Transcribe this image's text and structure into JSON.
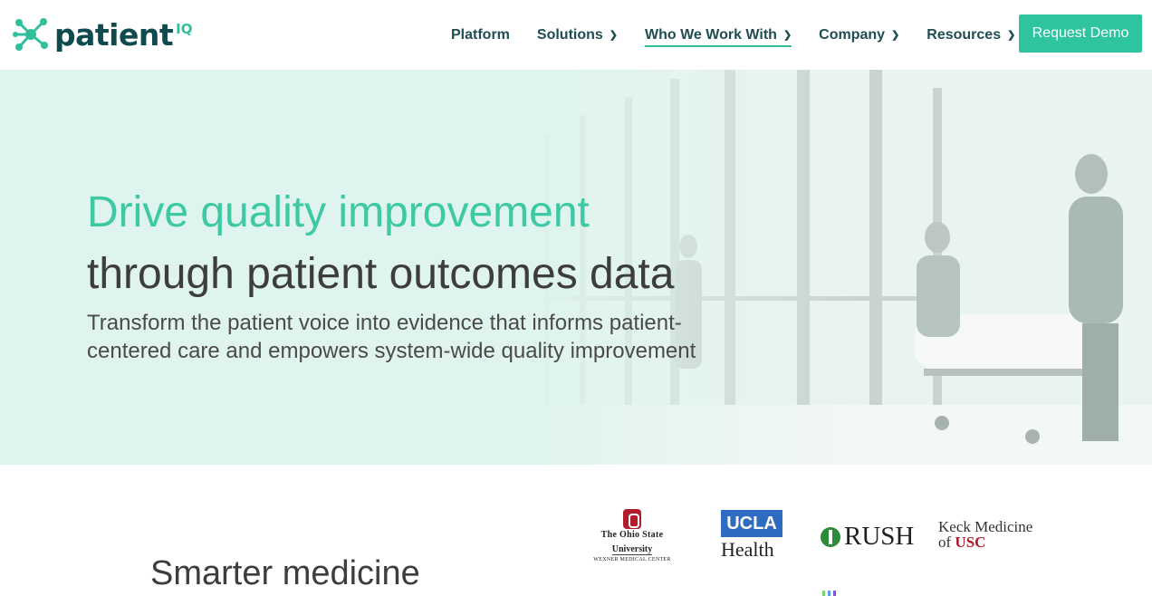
{
  "header": {
    "logo": {
      "brand": "patient",
      "suffix": "IQ",
      "icon": "network-nodes-icon"
    },
    "nav": [
      {
        "label": "Platform",
        "has_dropdown": false,
        "active": false
      },
      {
        "label": "Solutions",
        "has_dropdown": true,
        "active": false
      },
      {
        "label": "Who We Work With",
        "has_dropdown": true,
        "active": true
      },
      {
        "label": "Company",
        "has_dropdown": true,
        "active": false
      },
      {
        "label": "Resources",
        "has_dropdown": true,
        "active": false
      }
    ],
    "cta_label": "Request Demo"
  },
  "hero": {
    "title_line1": "Drive quality improvement",
    "title_line2": "through patient outcomes data",
    "subtitle": "Transform the patient voice into evidence that informs patient-centered care and empowers system-wide quality improvement"
  },
  "section": {
    "heading": "Smarter medicine"
  },
  "partner_logos": {
    "osu": {
      "line1": "The Ohio State",
      "line2": "University",
      "line3": "WEXNER MEDICAL CENTER"
    },
    "ucla": {
      "top": "UCLA",
      "bottom": "Health"
    },
    "rush": {
      "name": "RUSH"
    },
    "keck": {
      "line1": "Keck Medicine",
      "line2_prefix": "of ",
      "line2_emph": "USC"
    }
  },
  "colors": {
    "brand_teal": "#2ec4a0",
    "brand_dark": "#0f4a4e",
    "hero_bg": "#dff4ee",
    "title_accent": "#3cc9a3"
  }
}
